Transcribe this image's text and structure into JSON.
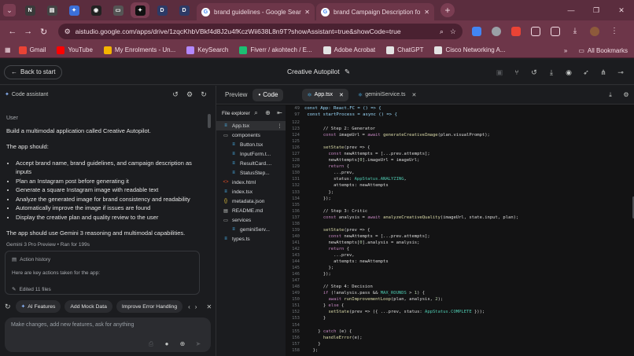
{
  "tabstrip": {
    "pinned": [
      {
        "name": "pinned-tab-n",
        "glyph": "N",
        "color": "#3a3a3a"
      },
      {
        "name": "pinned-tab-inbox",
        "glyph": "▤",
        "color": "#444"
      },
      {
        "name": "pinned-tab-gemini",
        "glyph": "✦",
        "color": "#3b6fd8"
      },
      {
        "name": "pinned-tab-github",
        "glyph": "◉",
        "color": "#222"
      },
      {
        "name": "pinned-tab-window",
        "glyph": "▭",
        "color": "#555"
      },
      {
        "name": "pinned-tab-app",
        "glyph": "✦",
        "color": "#111"
      },
      {
        "name": "pinned-tab-d1",
        "glyph": "D",
        "color": "#2d3a66"
      },
      {
        "name": "pinned-tab-d2",
        "glyph": "D",
        "color": "#2d3a66"
      }
    ],
    "tabs": [
      {
        "title": "brand guidelines - Google Sear",
        "close": "✕"
      },
      {
        "title": "brand Campaign Description fo",
        "close": "✕"
      }
    ],
    "new_tab": "+"
  },
  "window_controls": {
    "minimize": "—",
    "maximize": "❐",
    "close": "✕"
  },
  "address": {
    "url": "aistudio.google.com/apps/drive/1zqcKhbVBkf4d8J2u4fKczWii638L8n9T?showAssistant=true&showCode=true",
    "back": "←",
    "forward": "→",
    "reload": "↻"
  },
  "bookmarks": {
    "items": [
      {
        "label": "Gmail",
        "color": "#ea4335"
      },
      {
        "label": "YouTube",
        "color": "#ff0000"
      },
      {
        "label": "My Enrolments - Un...",
        "color": "#f4b400"
      },
      {
        "label": "KeySearch",
        "color": "#b388ff"
      },
      {
        "label": "Fiverr / akohtech / E...",
        "color": "#1dbf73"
      },
      {
        "label": "Adobe Acrobat",
        "color": "#e3e3e3"
      },
      {
        "label": "ChatGPT",
        "color": "#e3e3e3"
      },
      {
        "label": "Cisco Networking A...",
        "color": "#e3e3e3"
      }
    ],
    "all": "All Bookmarks"
  },
  "app": {
    "back_label": "Back to start",
    "title": "Creative Autopilot",
    "edit_icon": "✎"
  },
  "assistant": {
    "label": "Code assistant",
    "role": "User",
    "intro": "Build a multimodal application called Creative Autopilot.",
    "should": "The app should:",
    "bullets": [
      "Accept brand name, brand guidelines, and campaign description as inputs",
      "Plan an Instagram post before generating it",
      "Generate a square Instagram image with readable text",
      "Analyze the generated image for brand consistency and readability",
      "Automatically improve the image if issues are found",
      "Display the creative plan and quality review to the user"
    ],
    "closing": "The app should use Gemini 3 reasoning and multimodal capabilities.",
    "run_meta": "Gemini 3 Pro Preview  •  Ran for 199s",
    "action_history": "Action history",
    "action_desc": "Here are key actions taken for the app:",
    "edited": "Edited 11 files",
    "chips": [
      "AI Features",
      "Add Mock Data",
      "Improve Error Handling"
    ],
    "composer_placeholder": "Make changes, add new features, ask for anything"
  },
  "code_panel": {
    "tabs": {
      "preview": "Preview",
      "code": "Code"
    },
    "file_tabs": [
      "App.tsx",
      "geminiService.ts"
    ],
    "explorer_title": "File explorer",
    "files": [
      {
        "name": "App.tsx",
        "indent": 0,
        "icon": "≡",
        "color": "#4fc1ff",
        "selected": true
      },
      {
        "name": "components",
        "indent": 0,
        "icon": "▭",
        "color": "#c4c7c5"
      },
      {
        "name": "Button.tsx",
        "indent": 1,
        "icon": "≡",
        "color": "#4fc1ff"
      },
      {
        "name": "InputForm.t...",
        "indent": 1,
        "icon": "≡",
        "color": "#4fc1ff"
      },
      {
        "name": "ResultCard....",
        "indent": 1,
        "icon": "≡",
        "color": "#4fc1ff"
      },
      {
        "name": "StatusStep...",
        "indent": 1,
        "icon": "≡",
        "color": "#4fc1ff"
      },
      {
        "name": "index.html",
        "indent": 0,
        "icon": "<>",
        "color": "#e44d26"
      },
      {
        "name": "index.tsx",
        "indent": 0,
        "icon": "≡",
        "color": "#4fc1ff"
      },
      {
        "name": "metadata.json",
        "indent": 0,
        "icon": "{}",
        "color": "#f4d03f"
      },
      {
        "name": "README.md",
        "indent": 0,
        "icon": "▤",
        "color": "#c4c7c5"
      },
      {
        "name": "services",
        "indent": 0,
        "icon": "▭",
        "color": "#c4c7c5"
      },
      {
        "name": "geminiServ...",
        "indent": 1,
        "icon": "≡",
        "color": "#4fc1ff"
      },
      {
        "name": "types.ts",
        "indent": 0,
        "icon": "≡",
        "color": "#4fc1ff"
      }
    ],
    "sticky": [
      {
        "n": "49",
        "text": "const App: React.FC = () => {"
      },
      {
        "n": "97",
        "text": "  const startProcess = async () => {"
      }
    ],
    "lines": [
      {
        "n": "122",
        "text": ""
      },
      {
        "n": "123",
        "text": "      // Step 2: Generator",
        "cls": "cm"
      },
      {
        "n": "124",
        "text": "      const imageUrl = await generateCreativeImage(plan.visualPrompt);"
      },
      {
        "n": "125",
        "text": ""
      },
      {
        "n": "126",
        "text": "      setState(prev => {"
      },
      {
        "n": "127",
        "text": "        const newAttempts = [...prev.attempts];"
      },
      {
        "n": "128",
        "text": "        newAttempts[0].imageUrl = imageUrl;"
      },
      {
        "n": "129",
        "text": "        return {"
      },
      {
        "n": "130",
        "text": "          ...prev,"
      },
      {
        "n": "131",
        "text": "          status: AppStatus.ANALYZING,"
      },
      {
        "n": "132",
        "text": "          attempts: newAttempts"
      },
      {
        "n": "133",
        "text": "        };"
      },
      {
        "n": "134",
        "text": "      });"
      },
      {
        "n": "135",
        "text": ""
      },
      {
        "n": "136",
        "text": "      // Step 3: Critic",
        "cls": "cm"
      },
      {
        "n": "137",
        "text": "      const analysis = await analyzeCreativeQuality(imageUrl, state.input, plan);"
      },
      {
        "n": "138",
        "text": ""
      },
      {
        "n": "139",
        "text": "      setState(prev => {"
      },
      {
        "n": "140",
        "text": "        const newAttempts = [...prev.attempts];"
      },
      {
        "n": "141",
        "text": "        newAttempts[0].analysis = analysis;"
      },
      {
        "n": "142",
        "text": "        return {"
      },
      {
        "n": "143",
        "text": "          ...prev,"
      },
      {
        "n": "144",
        "text": "          attempts: newAttempts"
      },
      {
        "n": "145",
        "text": "        };"
      },
      {
        "n": "146",
        "text": "      });"
      },
      {
        "n": "147",
        "text": ""
      },
      {
        "n": "148",
        "text": "      // Step 4: Decision",
        "cls": "cm"
      },
      {
        "n": "149",
        "text": "      if (!analysis.pass && MAX_ROUNDS > 1) {"
      },
      {
        "n": "150",
        "text": "        await runImprovementLoop(plan, analysis, 2);"
      },
      {
        "n": "151",
        "text": "      } else {"
      },
      {
        "n": "152",
        "text": "        setState(prev => ({ ...prev, status: AppStatus.COMPLETE }));"
      },
      {
        "n": "153",
        "text": "      }"
      },
      {
        "n": "154",
        "text": ""
      },
      {
        "n": "155",
        "text": "    } catch (e) {"
      },
      {
        "n": "156",
        "text": "      handleError(e);"
      },
      {
        "n": "157",
        "text": "    }"
      },
      {
        "n": "158",
        "text": "  };"
      }
    ]
  }
}
